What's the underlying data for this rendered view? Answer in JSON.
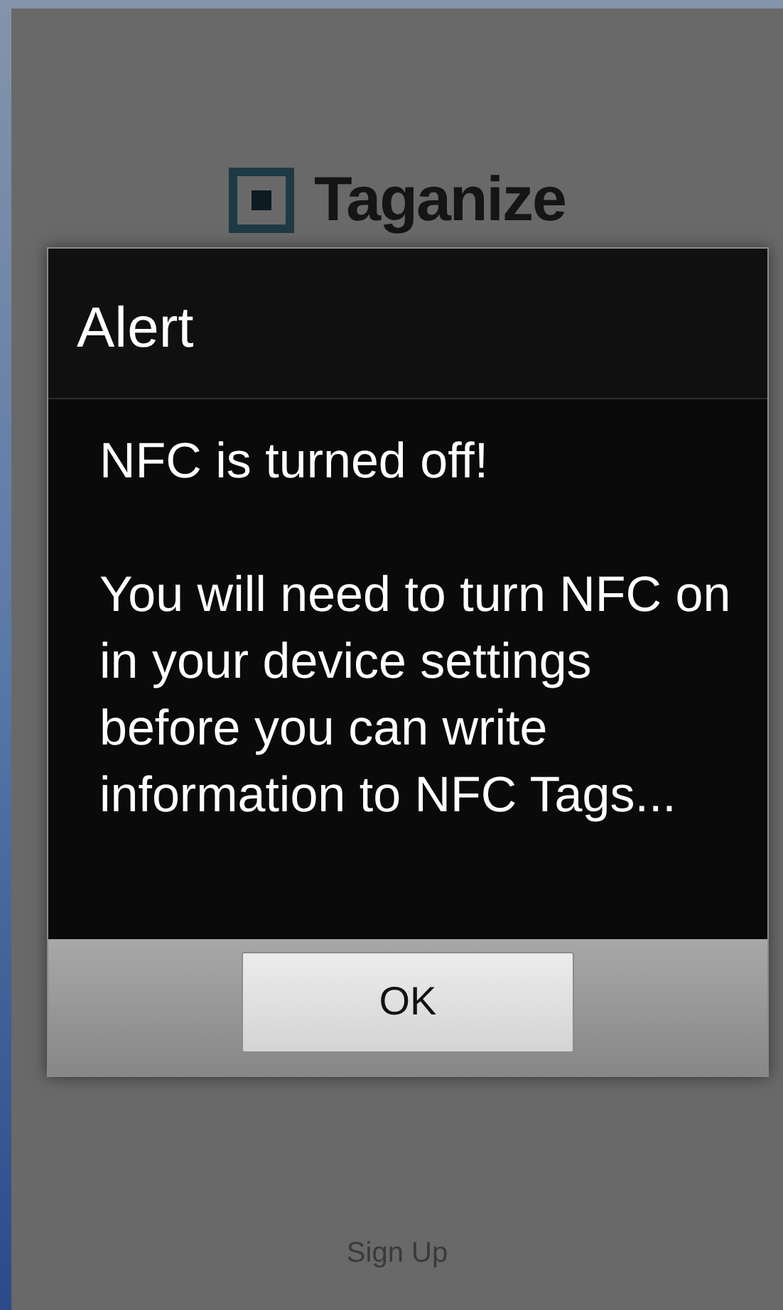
{
  "app": {
    "logo_text": "Taganize",
    "sign_up_link": "Sign Up"
  },
  "dialog": {
    "title": "Alert",
    "message": [
      "NFC is turned off!",
      "You will need to turn NFC on in your device settings before you can write information to NFC Tags..."
    ],
    "buttons": [
      "OK"
    ]
  }
}
